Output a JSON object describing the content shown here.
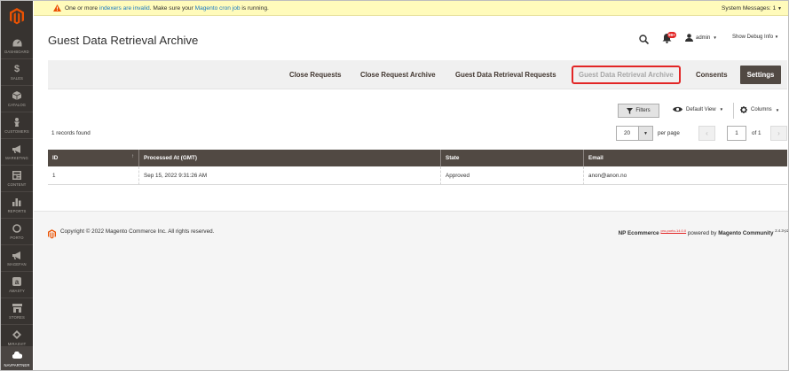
{
  "sidebar": {
    "items": [
      {
        "label": "DASHBOARD",
        "icon": "dashboard-icon"
      },
      {
        "label": "SALES",
        "icon": "dollar-icon"
      },
      {
        "label": "CATALOG",
        "icon": "cube-icon"
      },
      {
        "label": "CUSTOMERS",
        "icon": "customer-icon"
      },
      {
        "label": "MARKETING",
        "icon": "megaphone-icon"
      },
      {
        "label": "CONTENT",
        "icon": "content-icon"
      },
      {
        "label": "REPORTS",
        "icon": "bar-chart-icon"
      },
      {
        "label": "PORTO",
        "icon": "porto-icon"
      },
      {
        "label": "MAGEFAN",
        "icon": "megaphone-icon"
      },
      {
        "label": "AMASTY",
        "icon": "amasty-icon"
      },
      {
        "label": "STORES",
        "icon": "store-icon"
      },
      {
        "label": "MIRASVIT",
        "icon": "diamond-icon"
      },
      {
        "label": "NAVPARTNER",
        "icon": "navpartner-icon"
      }
    ]
  },
  "system_bar": {
    "text_before": "One or more ",
    "link1": "indexers are invalid",
    "text_middle": ". Make sure your ",
    "link2": "Magento cron job",
    "text_after": " is running.",
    "system_messages": "System Messages: 1"
  },
  "header": {
    "title": "Guest Data Retrieval Archive",
    "notifications_count": "99+",
    "user": "admin",
    "debug": "Show Debug Info"
  },
  "tabs": [
    {
      "label": "Close Requests"
    },
    {
      "label": "Close Request Archive"
    },
    {
      "label": "Guest Data Retrieval Requests"
    },
    {
      "label": "Guest Data Retrieval Archive",
      "active": true
    },
    {
      "label": "Consents"
    }
  ],
  "settings_label": "Settings",
  "toolbar": {
    "filters_label": "Filters",
    "view_label": "Default View",
    "columns_label": "Columns"
  },
  "pager": {
    "records_found": "1 records found",
    "per_page_value": "20",
    "per_page_label": "per page",
    "page_value": "1",
    "page_of": "of 1"
  },
  "grid": {
    "columns": [
      "ID",
      "Processed At (GMT)",
      "State",
      "Email"
    ],
    "rows": [
      {
        "id": "1",
        "processed_at": "Sep 15, 2022 9:31:26 AM",
        "state": "Approved",
        "email": "anon@anon.no"
      }
    ]
  },
  "footer": {
    "copyright": "Copyright © 2022 Magento Commerce Inc. All rights reserved.",
    "brand": "NP Ecommerce",
    "brand_sup": "pro-porto-14.0.0",
    "powered_by": " powered by ",
    "magento": "Magento Community",
    "version": "2.4.3-p2"
  },
  "colors": {
    "sidebar_bg": "#373330",
    "logo_orange": "#eb5202",
    "grid_header": "#514943",
    "highlight_red": "#e22626",
    "system_bar": "#fffbbb",
    "link_blue": "#1979c3"
  }
}
